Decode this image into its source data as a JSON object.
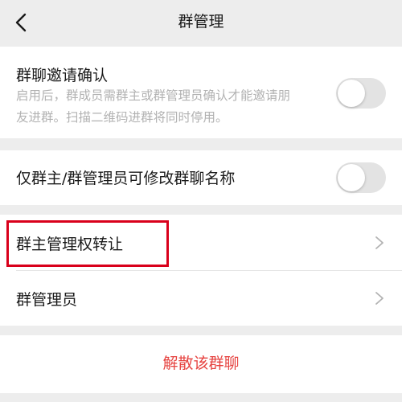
{
  "header": {
    "title": "群管理"
  },
  "invite_confirm": {
    "label": "群聊邀请确认",
    "desc_line1": "启用后，群成员需群主或群管理员确认才能邀请朋",
    "desc_line2": "友进群。扫描二维码进群将同时停用。",
    "enabled": false
  },
  "rename_restrict": {
    "label": "仅群主/群管理员可修改群聊名称",
    "enabled": false
  },
  "menu": {
    "transfer_label": "群主管理权转让",
    "admins_label": "群管理员"
  },
  "dissolve": {
    "label": "解散该群聊"
  },
  "colors": {
    "danger": "#e64340",
    "highlight": "#d9001b",
    "toggle_off": "#e3e3e3"
  }
}
